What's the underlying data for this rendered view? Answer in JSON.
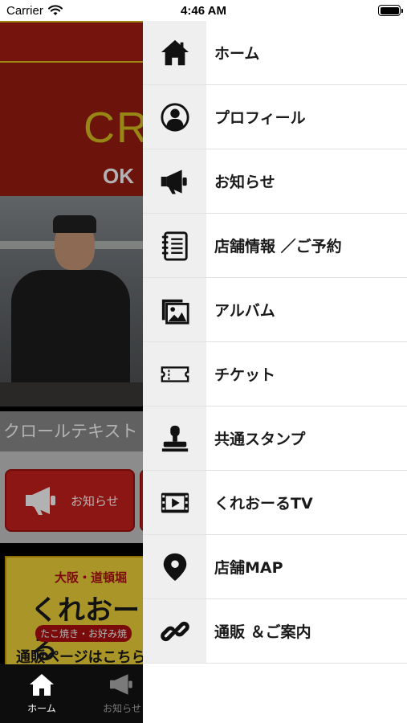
{
  "status_bar": {
    "carrier": "Carrier",
    "time": "4:46 AM"
  },
  "background": {
    "hero": {
      "logo_text": "CR",
      "sub_text": "OK"
    },
    "scroll_text": "クロールテキスト",
    "notice_button_label": "お知らせ",
    "banner": {
      "top": "大阪・道頓堀",
      "main": "くれおーる",
      "sub": "たこ焼き・お好み焼",
      "link": "通販ページはこちら"
    },
    "tabbar": {
      "home_label": "ホーム",
      "notice_label": "お知らせ"
    }
  },
  "drawer": {
    "items": [
      {
        "label": "ホーム",
        "icon": "home-icon"
      },
      {
        "label": "プロフィール",
        "icon": "profile-icon"
      },
      {
        "label": "お知らせ",
        "icon": "megaphone-icon"
      },
      {
        "label": "店舗情報 ／ご予約",
        "icon": "notebook-icon"
      },
      {
        "label": "アルバム",
        "icon": "album-icon"
      },
      {
        "label": "チケット",
        "icon": "ticket-icon"
      },
      {
        "label": "共通スタンプ",
        "icon": "stamp-icon"
      },
      {
        "label": "くれおーるTV",
        "icon": "tv-icon"
      },
      {
        "label": "店舗MAP",
        "icon": "map-pin-icon"
      },
      {
        "label": "通販 ＆ご案内",
        "icon": "link-icon"
      }
    ]
  },
  "colors": {
    "hero_red": "#9b1c12",
    "button_red": "#c8201c",
    "logo_yellow": "#d8c21e",
    "drawer_icon_bg": "#efefef"
  }
}
